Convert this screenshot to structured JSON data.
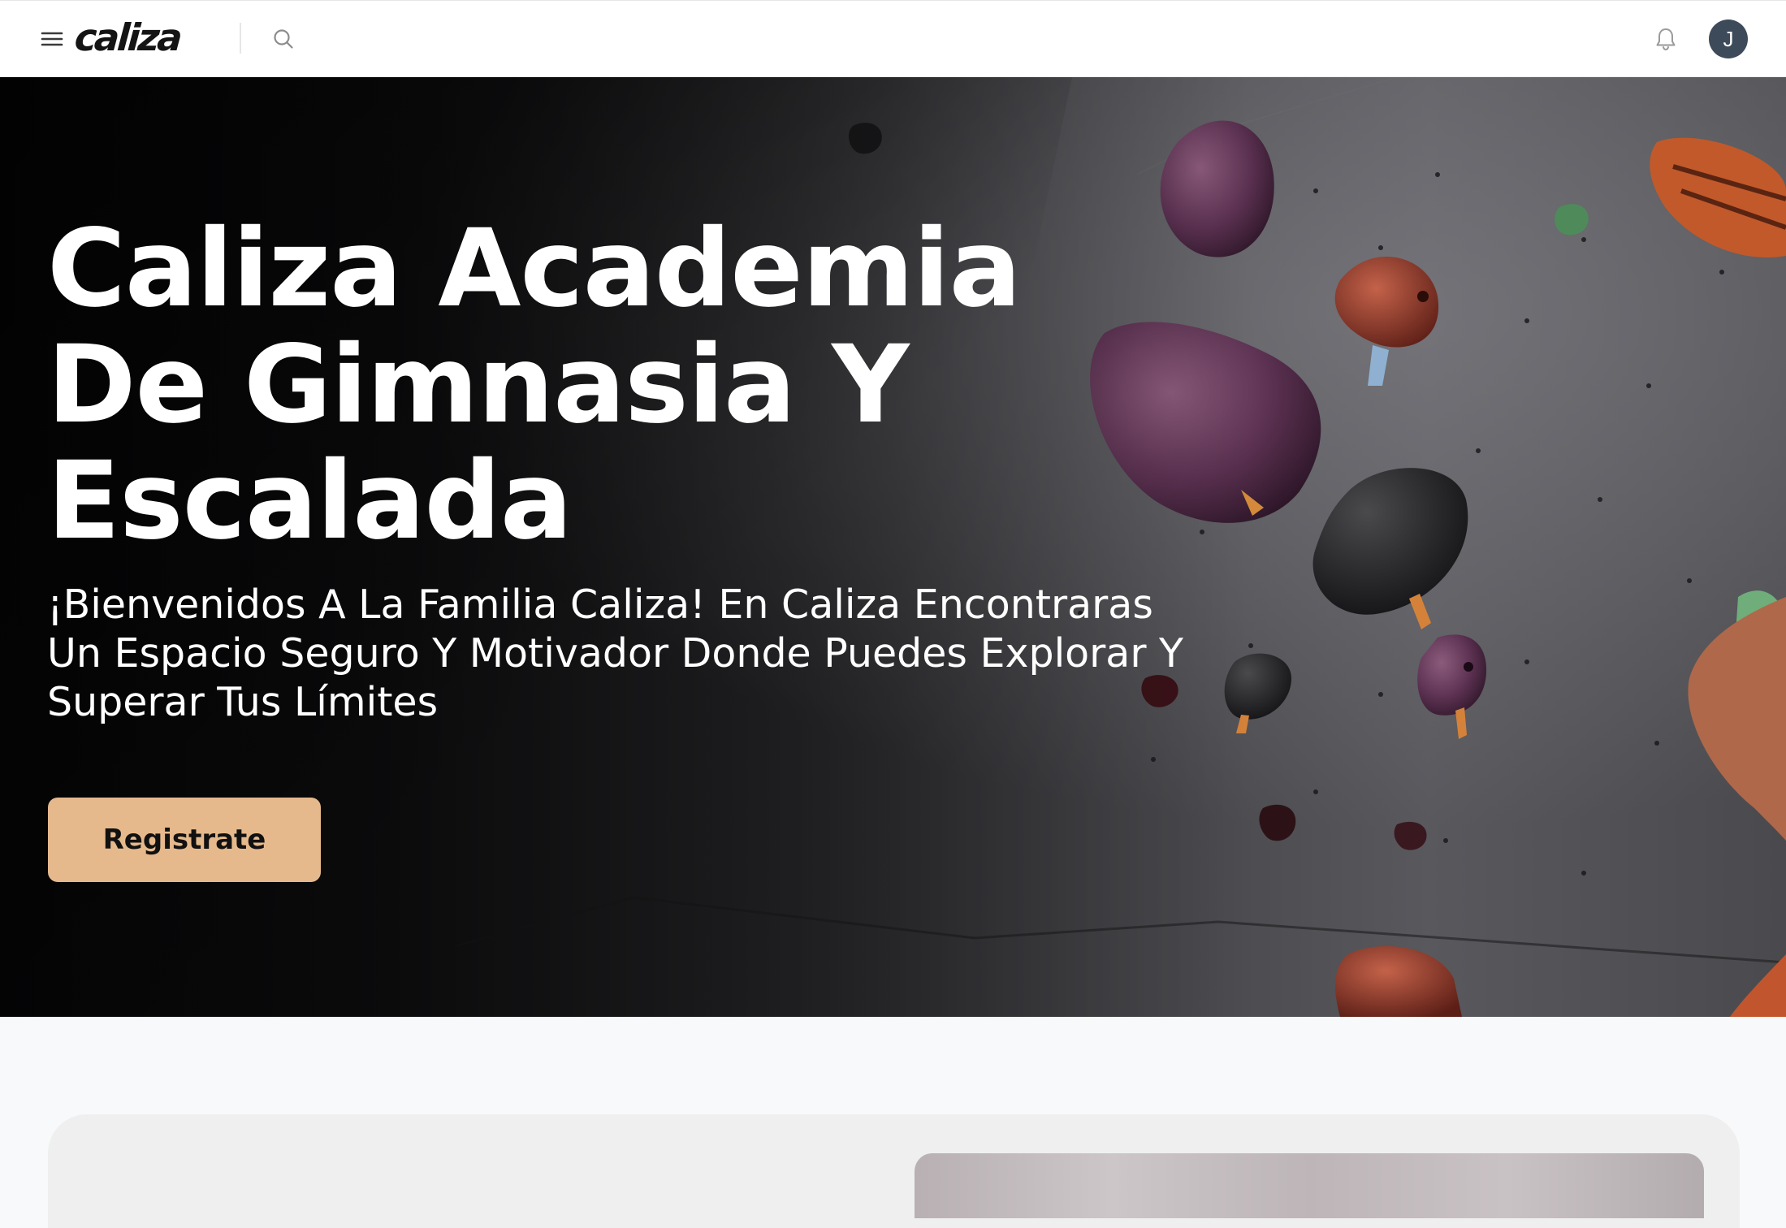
{
  "header": {
    "logo_text": "caliza",
    "avatar_initial": "J"
  },
  "hero": {
    "title": "Caliza Academia De Gimnasia Y Escalada",
    "subtitle": "¡Bienvenidos A La Familia Caliza! En Caliza Encontraras Un Espacio Seguro Y Motivador Donde Puedes Explorar Y Superar Tus Límites",
    "cta_label": "Registrate"
  },
  "colors": {
    "cta_background": "#e6b98c",
    "avatar_background": "#3d4a5a",
    "page_background": "#f8f9fb",
    "card_background": "#efefef"
  },
  "icons": {
    "menu": "hamburger-menu-icon",
    "search": "magnifier-icon",
    "notifications": "bell-icon"
  }
}
